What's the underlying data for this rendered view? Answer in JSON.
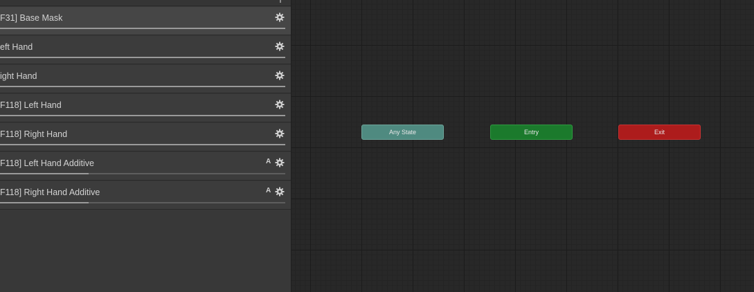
{
  "layers": [
    {
      "name": "F31] Base Mask",
      "selected": true,
      "additive": false,
      "badge": "",
      "weight": 1.0
    },
    {
      "name": "eft Hand",
      "selected": false,
      "additive": false,
      "badge": "",
      "weight": 1.0
    },
    {
      "name": "ight Hand",
      "selected": false,
      "additive": false,
      "badge": "",
      "weight": 1.0
    },
    {
      "name": "F118] Left Hand",
      "selected": false,
      "additive": false,
      "badge": "",
      "weight": 1.0
    },
    {
      "name": "F118] Right Hand",
      "selected": false,
      "additive": false,
      "badge": "",
      "weight": 1.0
    },
    {
      "name": "F118] Left Hand Additive",
      "selected": false,
      "additive": true,
      "badge": "A",
      "weight": 0.31
    },
    {
      "name": "F118] Right Hand Additive",
      "selected": false,
      "additive": true,
      "badge": "A",
      "weight": 0.31
    }
  ],
  "icons": {
    "layer_settings": "gear-icon"
  },
  "graph": {
    "nodes": [
      {
        "id": "any-state",
        "label": "Any State",
        "color": "#4f8a80"
      },
      {
        "id": "entry",
        "label": "Entry",
        "color": "#1b7a2c"
      },
      {
        "id": "exit",
        "label": "Exit",
        "color": "#ad1c1c"
      }
    ]
  }
}
